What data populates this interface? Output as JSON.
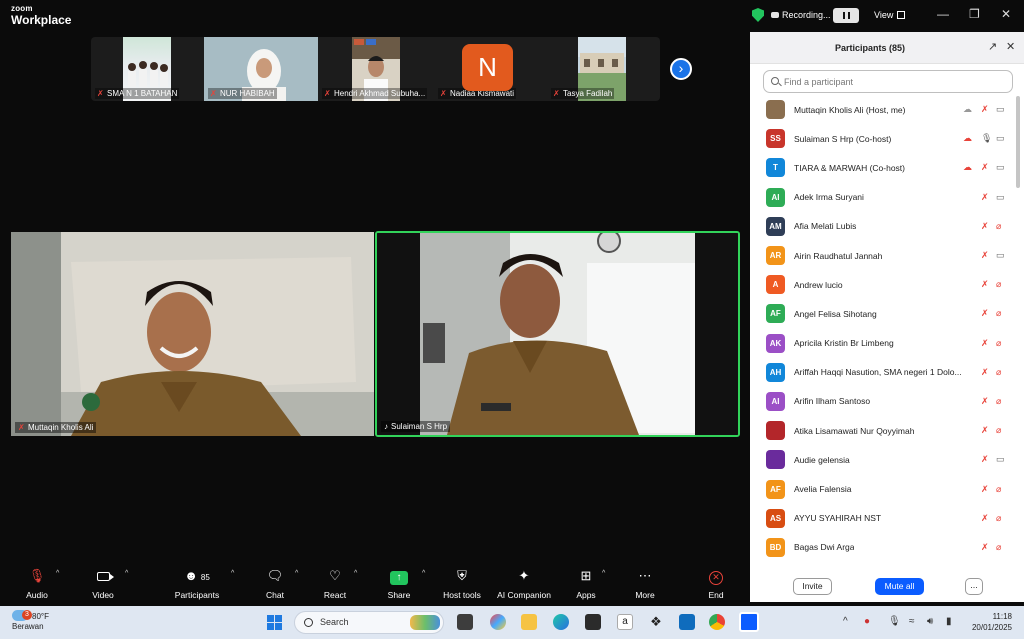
{
  "app": {
    "brand_small": "zoom",
    "brand_large": "Workplace"
  },
  "titlebar": {
    "recording_label": "Recording...",
    "view_label": "View"
  },
  "thumbnails": [
    {
      "name": "SMA N 1 BATAHAN"
    },
    {
      "name": "NUR HABIBAH"
    },
    {
      "name": "Hendri Akhmad Subuha..."
    },
    {
      "name": "Nadiaa Kismawati",
      "initial": "N"
    },
    {
      "name": "Tasya Fadilah"
    }
  ],
  "videos": [
    {
      "name": "Muttaqin Kholis Ali"
    },
    {
      "name": "Sulaiman S Hrp"
    }
  ],
  "participants_panel": {
    "title": "Participants (85)",
    "search_placeholder": "Find a participant",
    "invite_label": "Invite",
    "mute_all_label": "Mute all",
    "more_label": "...",
    "rows": [
      {
        "name": "Muttaqin Kholis Ali (Host, me)",
        "avatar": "",
        "color": "#8a6e4f",
        "video_off": false
      },
      {
        "name": "Sulaiman S Hrp (Co-host)",
        "avatar": "SS",
        "color": "#c8352b",
        "video_off": false
      },
      {
        "name": "TIARA & MARWAH (Co-host)",
        "avatar": "T",
        "color": "#1187d9",
        "video_off": false
      },
      {
        "name": "Adek Irma Suryani",
        "avatar": "AI",
        "color": "#2eac56",
        "video_off": false
      },
      {
        "name": "Afia Melati Lubis",
        "avatar": "AM",
        "color": "#2f3e57",
        "video_off": true
      },
      {
        "name": "Airin Raudhatul Jannah",
        "avatar": "AR",
        "color": "#f29419",
        "video_off": false
      },
      {
        "name": "Andrew lucio",
        "avatar": "A",
        "color": "#ef5a23",
        "video_off": true
      },
      {
        "name": "Angel Felisa Sihotang",
        "avatar": "AF",
        "color": "#2eac56",
        "video_off": true
      },
      {
        "name": "Apricila Kristin Br Limbeng",
        "avatar": "AK",
        "color": "#9b4fc6",
        "video_off": true
      },
      {
        "name": "Ariffah Haqqi Nasution, SMA negeri 1 Dolo...",
        "avatar": "AH",
        "color": "#1187d9",
        "video_off": true
      },
      {
        "name": "Arifin Ilham Santoso",
        "avatar": "AI",
        "color": "#9b4fc6",
        "video_off": true
      },
      {
        "name": "Atika Lisamawati Nur Qoyyimah",
        "avatar": "",
        "color": "#b3262a",
        "video_off": true
      },
      {
        "name": "Audie gelensia",
        "avatar": "",
        "color": "#6a2b9c",
        "video_off": false
      },
      {
        "name": "Avelia Falensia",
        "avatar": "AF",
        "color": "#f29419",
        "video_off": true
      },
      {
        "name": "AYYU SYAHIRAH NST",
        "avatar": "AS",
        "color": "#d84d12",
        "video_off": true
      },
      {
        "name": "Bagas Dwi Arga",
        "avatar": "BD",
        "color": "#f29419",
        "video_off": true
      }
    ]
  },
  "toolbar": {
    "audio": "Audio",
    "video": "Video",
    "participants": "Participants",
    "participants_count": "85",
    "chat": "Chat",
    "react": "React",
    "share": "Share",
    "host_tools": "Host tools",
    "ai_companion": "AI Companion",
    "apps": "Apps",
    "more": "More",
    "end": "End"
  },
  "taskbar": {
    "weather_temp": "80°F",
    "weather_desc": "Berawan",
    "weather_badge": "3",
    "search_label": "Search",
    "time": "11:18",
    "date": "20/01/2025"
  },
  "colors": {
    "accent": "#0b5cff",
    "active_speaker": "#32d35a",
    "muted": "#e8433a"
  }
}
